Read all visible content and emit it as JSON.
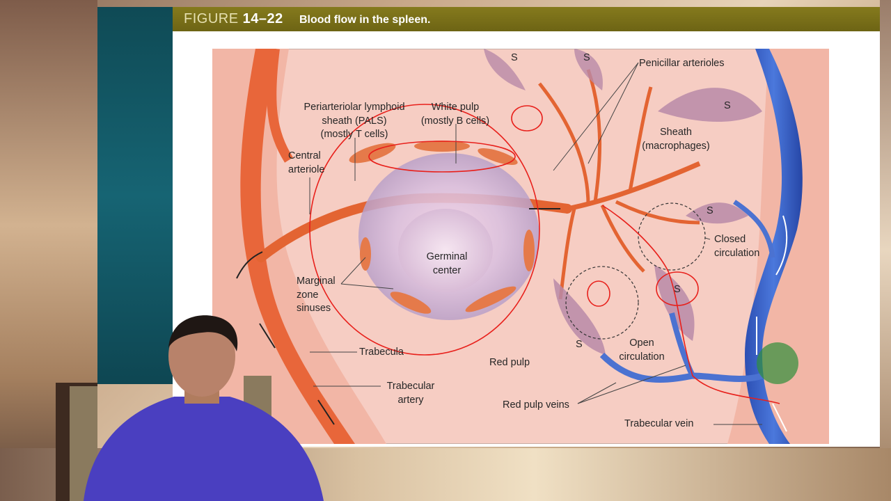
{
  "figure": {
    "label": "FIGURE",
    "number": "14–22",
    "title": "Blood flow in the spleen."
  },
  "labels": {
    "pals_1": "Periarteriolar lymphoid",
    "pals_2": "sheath (PALS)",
    "pals_3": "(mostly T cells)",
    "white_pulp_1": "White pulp",
    "white_pulp_2": "(mostly B cells)",
    "central_1": "Central",
    "central_2": "arteriole",
    "penicillar": "Penicillar arterioles",
    "sheath_1": "Sheath",
    "sheath_2": "(macrophages)",
    "germinal_1": "Germinal",
    "germinal_2": "center",
    "marginal_1": "Marginal",
    "marginal_2": "zone",
    "marginal_3": "sinuses",
    "closed_1": "Closed",
    "closed_2": "circulation",
    "open_1": "Open",
    "open_2": "circulation",
    "trabecula": "Trabecula",
    "red_pulp": "Red pulp",
    "trab_artery_1": "Trabecular",
    "trab_artery_2": "artery",
    "red_pulp_veins": "Red pulp veins",
    "trab_vein": "Trabecular vein",
    "s": "S"
  },
  "colors": {
    "accent_bar": "#7a7018",
    "teal_panel": "#166473",
    "artery": "#e8663a",
    "vein": "#3a5fc4",
    "annotation": "#e8201b"
  }
}
